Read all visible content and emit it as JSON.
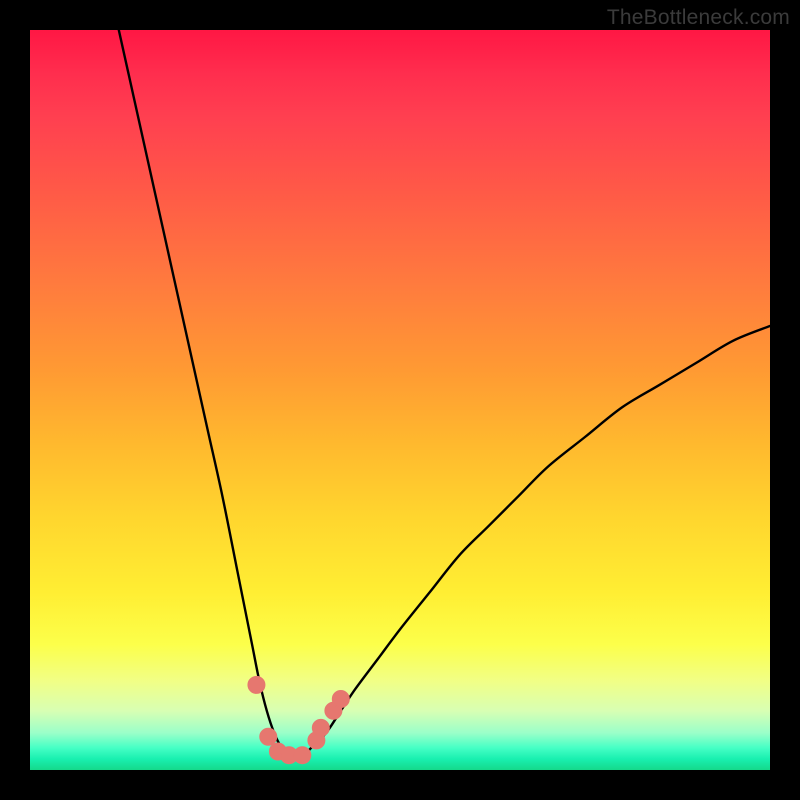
{
  "watermark": "TheBottleneck.com",
  "colors": {
    "curve_stroke": "#000000",
    "marker_fill": "#e6776f",
    "marker_stroke": "#e6776f"
  },
  "chart_data": {
    "type": "line",
    "title": "",
    "xlabel": "",
    "ylabel": "",
    "xlim": [
      0,
      100
    ],
    "ylim": [
      0,
      100
    ],
    "series": [
      {
        "name": "curve",
        "x": [
          12,
          14,
          16,
          18,
          20,
          22,
          24,
          26,
          28,
          29,
          30,
          31,
          32,
          33,
          34,
          35,
          36,
          37,
          38,
          40,
          42,
          44,
          47,
          50,
          54,
          58,
          62,
          66,
          70,
          75,
          80,
          85,
          90,
          95,
          100
        ],
        "y": [
          100,
          91,
          82,
          73,
          64,
          55,
          46,
          37,
          27,
          22,
          17,
          12,
          8,
          5,
          3,
          2,
          2,
          2,
          3,
          5,
          8,
          11,
          15,
          19,
          24,
          29,
          33,
          37,
          41,
          45,
          49,
          52,
          55,
          58,
          60
        ]
      }
    ],
    "markers": {
      "x": [
        30.6,
        32.2,
        33.5,
        35.0,
        36.8,
        38.7,
        39.3,
        41.0,
        42.0
      ],
      "y": [
        11.5,
        4.5,
        2.5,
        2.0,
        2.0,
        4.0,
        5.7,
        8.0,
        9.6
      ]
    }
  }
}
